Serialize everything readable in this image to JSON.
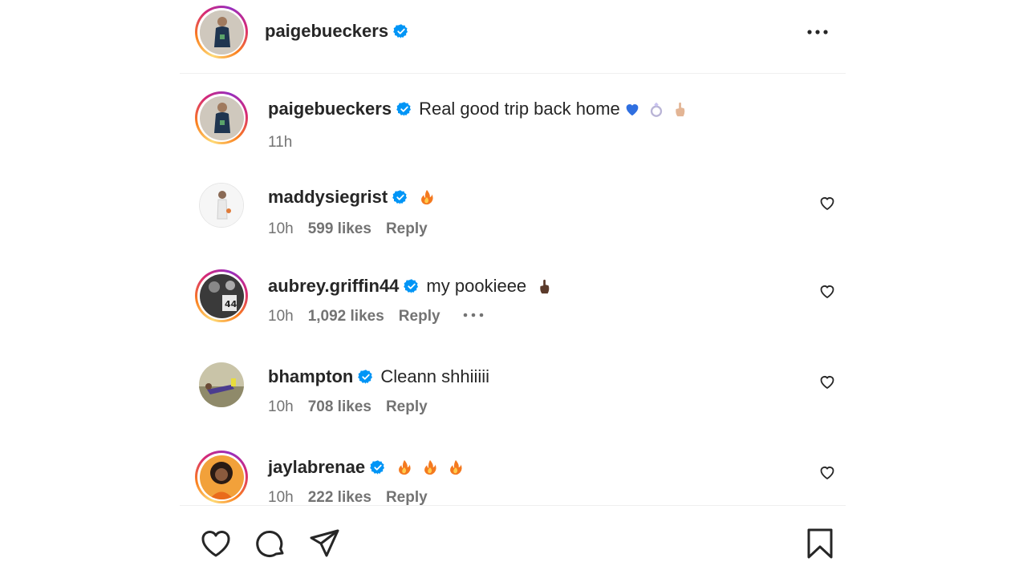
{
  "header": {
    "username": "paigebueckers",
    "avatar_icon": "user-avatar-basketball",
    "verified_icon": "verified-badge-icon",
    "more_icon": "more-options-icon"
  },
  "caption": {
    "username": "paigebueckers",
    "text": "Real good trip back home",
    "emojis": [
      "blue-heart",
      "ring",
      "crossed-fingers"
    ],
    "time": "11h"
  },
  "comments": [
    {
      "username": "maddysiegrist",
      "text": "",
      "emojis": [
        "fire"
      ],
      "time": "10h",
      "likes": "599 likes",
      "reply": "Reply"
    },
    {
      "username": "aubrey.griffin44",
      "text": "my pookieee",
      "emojis": [
        "crossed-fingers-dark"
      ],
      "time": "10h",
      "likes": "1,092 likes",
      "reply": "Reply"
    },
    {
      "username": "bhampton",
      "text": "Cleann shhiiiii",
      "emojis": [],
      "time": "10h",
      "likes": "708 likes",
      "reply": "Reply"
    },
    {
      "username": "jaylabrenae",
      "text": "",
      "emojis": [
        "fire",
        "fire",
        "fire"
      ],
      "time": "10h",
      "likes": "222 likes",
      "reply": "Reply"
    }
  ],
  "footer": {
    "icons": [
      "like-icon",
      "comment-icon",
      "share-icon",
      "save-icon"
    ]
  },
  "colors": {
    "verified": "#0095f6",
    "meta_text": "#737373",
    "primary_text": "#262626"
  }
}
